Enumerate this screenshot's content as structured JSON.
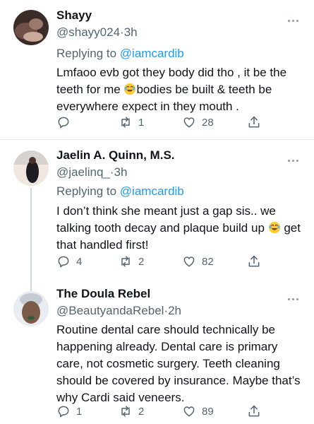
{
  "tweets": [
    {
      "name": "Shayy",
      "handle": "@shayy024",
      "time": "3h",
      "replying_label": "Replying to",
      "replying_to": "@iamcardib",
      "body_parts": [
        "Lmfaoo evb got they body did tho , it be the teeth for me ",
        "bodies be built & teeth be everywhere expect in they mouth ."
      ],
      "emoji": "laughing-emoji",
      "replies": "",
      "retweets": "1",
      "likes": "28"
    },
    {
      "name": "Jaelin A. Quinn, M.S.",
      "handle": "@jaelinq_",
      "time": "3h",
      "replying_label": "Replying to",
      "replying_to": "@iamcardib",
      "body_parts": [
        "I don’t think she meant just a gap sis.. we talking tooth decay and plaque build up ",
        " get that handled first!"
      ],
      "emoji": "laughing-emoji",
      "replies": "4",
      "retweets": "2",
      "likes": "82"
    },
    {
      "name": "The Doula Rebel",
      "handle": "@BeautyandaRebel",
      "time": "2h",
      "body": "Routine dental care should technically be happening already. Dental care is primary care, not cosmetic surgery. Teeth cleaning should be covered by insurance. Maybe that’s why Cardi said veneers.",
      "replies": "1",
      "retweets": "2",
      "likes": "89"
    }
  ],
  "separator": "·",
  "colors": {
    "text": "#0f1419",
    "secondary": "#536471",
    "link": "#1d9bf0",
    "divider": "#e7eaec",
    "thread_line": "#cfd9de"
  },
  "icons": [
    "more-icon",
    "reply-icon",
    "retweet-icon",
    "like-icon",
    "share-icon"
  ]
}
